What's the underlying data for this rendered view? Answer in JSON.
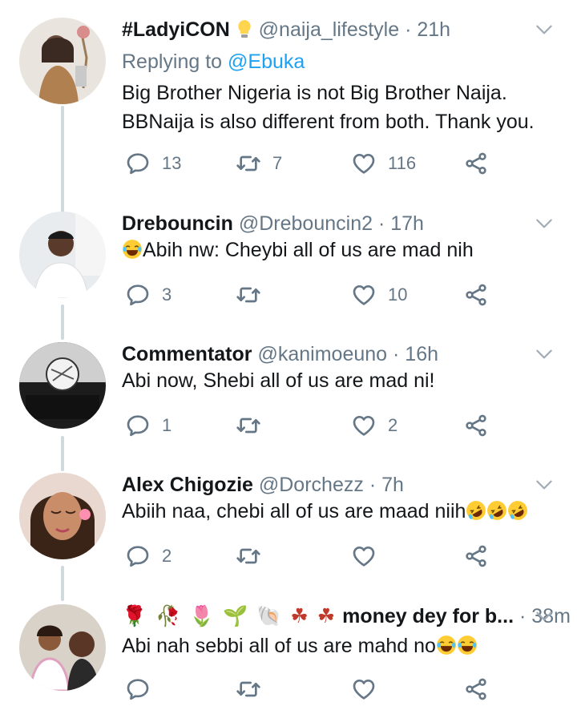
{
  "tweets": [
    {
      "name": "#LadyiCON",
      "handle": "@naija_lifestyle",
      "time": "21h",
      "replying_label": "Replying to",
      "replying_to": "@Ebuka",
      "text_line1": "Big Brother Nigeria is not Big Brother Naija.",
      "text_line2": "BBNaija is also different from both. Thank you.",
      "replies": "13",
      "retweets": "7",
      "likes": "116"
    },
    {
      "name": "Drebouncin",
      "handle": "@Drebouncin2",
      "time": "17h",
      "text": "Abih nw: Cheybi all of us are mad nih",
      "replies": "3",
      "retweets": "",
      "likes": "10"
    },
    {
      "name": "Commentator",
      "handle": "@kanimoeuno",
      "time": "16h",
      "text": "Abi now, Shebi all of us are mad ni!",
      "replies": "1",
      "retweets": "",
      "likes": "2"
    },
    {
      "name": "Alex Chigozie",
      "handle": "@Dorchezz",
      "time": "7h",
      "text": "Abiih naa, chebi all of us are maad niih",
      "replies": "2",
      "retweets": "",
      "likes": ""
    },
    {
      "name": "money dey for b...",
      "time": "38m",
      "text": "Abi nah sebbi all of us are mahd no",
      "replies": "",
      "retweets": "",
      "likes": ""
    }
  ],
  "separator": "·",
  "colors": {
    "text": "#14171a",
    "secondary": "#657786",
    "link": "#1da1f2",
    "thread": "#cfd9de"
  },
  "icons": [
    "reply-icon",
    "retweet-icon",
    "like-icon",
    "share-icon",
    "chevron-down-icon",
    "lightbulb-icon",
    "laughing-emoji",
    "rofl-emoji",
    "flower-emoji"
  ]
}
